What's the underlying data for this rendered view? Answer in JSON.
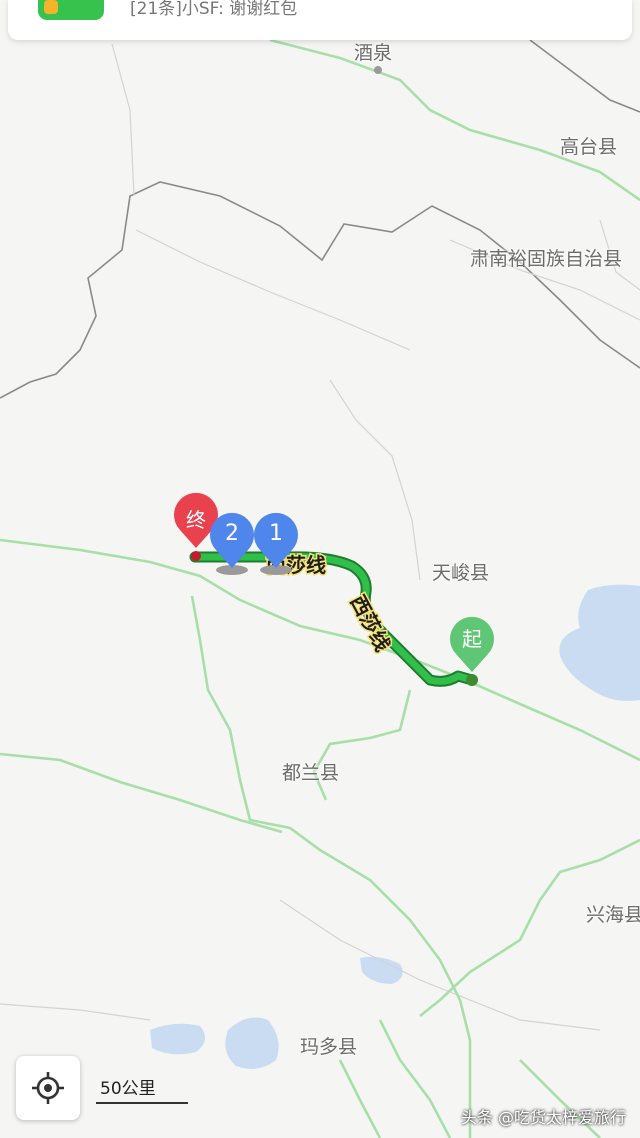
{
  "notification": {
    "message": "[21条]小SF: 谢谢红包"
  },
  "places": {
    "jiuquan": "酒泉",
    "gaotai": "高台县",
    "sunan": "肃南裕固族自治县",
    "tianjun": "天峻县",
    "dulan": "都兰县",
    "xinghai": "兴海县",
    "maduo": "玛多县"
  },
  "route": {
    "road_label_1": "西莎线",
    "road_label_2": "西莎线",
    "start_label": "起",
    "end_label": "终",
    "waypoint_1": "1",
    "waypoint_2": "2",
    "route_color": "#23a33a",
    "start_color": "#5fc675",
    "end_color": "#e9424e",
    "waypoint_color": "#4f86ec"
  },
  "controls": {
    "locate_icon": "locate-crosshair-icon",
    "scale_label": "50公里"
  },
  "watermark": "头条 @吃货太梓爱旅行"
}
